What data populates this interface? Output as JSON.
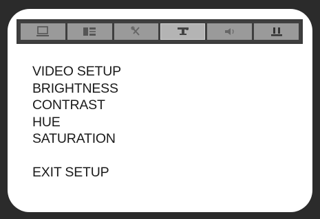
{
  "tabs": [
    {
      "icon": "monitor-icon"
    },
    {
      "icon": "language-icon"
    },
    {
      "icon": "tools-icon"
    },
    {
      "icon": "video-setup-icon",
      "active": true
    },
    {
      "icon": "speaker-icon"
    },
    {
      "icon": "preference-icon"
    }
  ],
  "menu": {
    "items": [
      {
        "label": "VIDEO SETUP"
      },
      {
        "label": "BRIGHTNESS"
      },
      {
        "label": "CONTRAST"
      },
      {
        "label": "HUE"
      },
      {
        "label": "SATURATION"
      }
    ],
    "exit_label": "EXIT SETUP"
  }
}
